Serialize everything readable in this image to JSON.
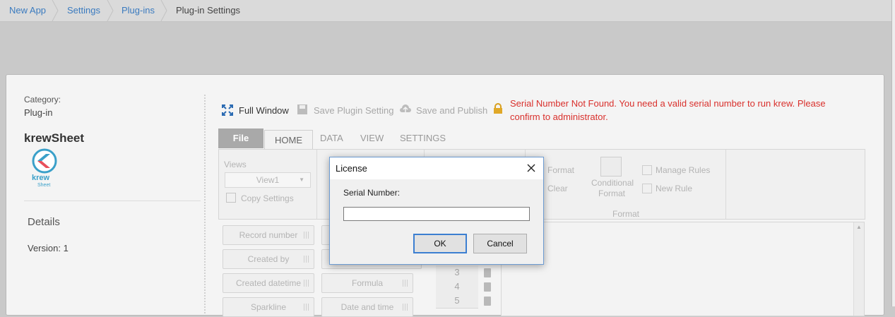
{
  "breadcrumb": [
    "New App",
    "Settings",
    "Plug-ins",
    "Plug-in Settings"
  ],
  "sidebar": {
    "category_label": "Category:",
    "category_value": "Plug-in",
    "app_name": "krewSheet",
    "logo_text": "krew",
    "logo_sub": "Sheet",
    "details_heading": "Details",
    "version": "Version: 1"
  },
  "toolbar": {
    "full_window": "Full Window",
    "save_plugin": "Save Plugin Setting",
    "save_publish": "Save and Publish",
    "error": "Serial Number Not Found. You need a valid serial number to run krew. Please confirm to administrator."
  },
  "tabs": [
    "File",
    "HOME",
    "DATA",
    "VIEW",
    "SETTINGS"
  ],
  "ribbon": {
    "views_label": "Views",
    "view_selected": "View1",
    "copy_settings": "Copy Settings",
    "format": "Format",
    "clear": "Clear",
    "conditional_format": "Conditional Format",
    "manage_rules": "Manage Rules",
    "new_rule": "New Rule",
    "format_group": "Format"
  },
  "fields": [
    "Record number",
    "Created by",
    "Created datetime",
    "Formula",
    "Sparkline",
    "Date and time"
  ],
  "rows": [
    "3",
    "4",
    "5"
  ],
  "dialog": {
    "title": "License",
    "label": "Serial Number:",
    "value": "",
    "ok": "OK",
    "cancel": "Cancel"
  },
  "colors": {
    "link": "#3b7bbf",
    "error": "#d9302c",
    "dialog_border": "#6c9bd2"
  }
}
